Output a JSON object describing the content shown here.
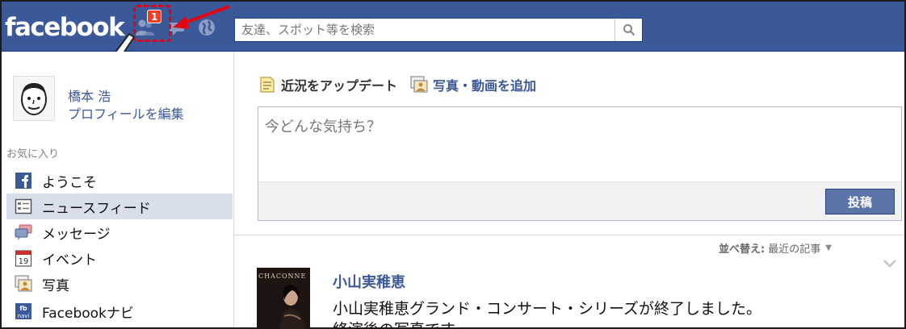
{
  "header": {
    "logo": "facebook",
    "notification_count": "1",
    "search_placeholder": "友達、スポット等を検索"
  },
  "profile": {
    "name": "橋本 浩",
    "edit_link": "プロフィールを編集"
  },
  "sidebar": {
    "favorites_header": "お気に入り",
    "items": [
      {
        "label": "ようこそ",
        "icon": "facebook-f-icon"
      },
      {
        "label": "ニュースフィード",
        "icon": "news-feed-icon",
        "selected": true
      },
      {
        "label": "メッセージ",
        "icon": "messages-icon"
      },
      {
        "label": "イベント",
        "icon": "calendar-icon",
        "icon_text": "19"
      },
      {
        "label": "写真",
        "icon": "photos-icon"
      },
      {
        "label": "Facebookナビ",
        "icon": "fb-navi-icon",
        "icon_text_top": "fb",
        "icon_text_bottom": "navi"
      }
    ]
  },
  "composer": {
    "tab_status": "近況をアップデート",
    "tab_photo": "写真・動画を追加",
    "placeholder": "今どんな気持ち？",
    "post_button": "投稿"
  },
  "feed": {
    "sort_label": "並べ替え:",
    "sort_value": "最近の記事",
    "story": {
      "thumbnail_text": "CHACONNE",
      "author": "小山実稚恵",
      "line1": "小山実稚恵グランド・コンサート・シリーズが終了しました。",
      "line2": "終演後の写真です。"
    }
  },
  "colors": {
    "brand_blue": "#3b5998",
    "badge_red": "#f03d25",
    "annotation_red": "#e60012",
    "selected_bg": "#d8dfea"
  }
}
